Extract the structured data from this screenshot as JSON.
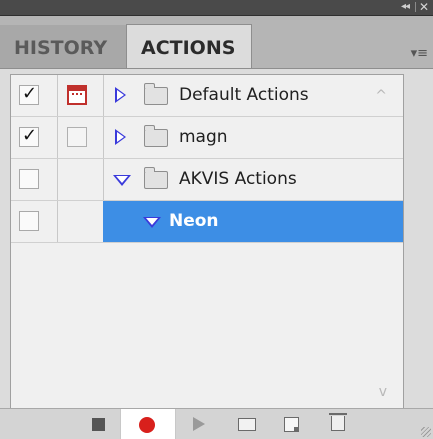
{
  "window": {
    "collapse_glyph": "◂◂",
    "close_glyph": "✕"
  },
  "tabs": [
    {
      "label": "HISTORY",
      "active": false
    },
    {
      "label": "ACTIONS",
      "active": true
    }
  ],
  "panel_menu_glyph": "▾≡",
  "actions": [
    {
      "label": "Default Actions",
      "type": "set",
      "expanded": false,
      "checked": true,
      "dialog_on": true
    },
    {
      "label": "magn",
      "type": "set",
      "expanded": false,
      "checked": true,
      "dialog_on": false
    },
    {
      "label": "AKVIS Actions",
      "type": "set",
      "expanded": true,
      "checked": false,
      "dialog_on": false
    },
    {
      "label": "Neon",
      "type": "action",
      "expanded": true,
      "checked": false,
      "dialog_on": false,
      "selected": true
    }
  ],
  "colors": {
    "selection": "#3d8ee5",
    "record": "#d8201c",
    "dialog_toggle": "#c0302c",
    "disclosure": "#3a3adb"
  },
  "bottom_icons": [
    "stop-icon",
    "record-icon",
    "play-icon",
    "new-set-icon",
    "new-action-icon",
    "delete-icon"
  ],
  "glyphs": {
    "check": "✓",
    "scroll_up": "^",
    "scroll_down": "v"
  }
}
